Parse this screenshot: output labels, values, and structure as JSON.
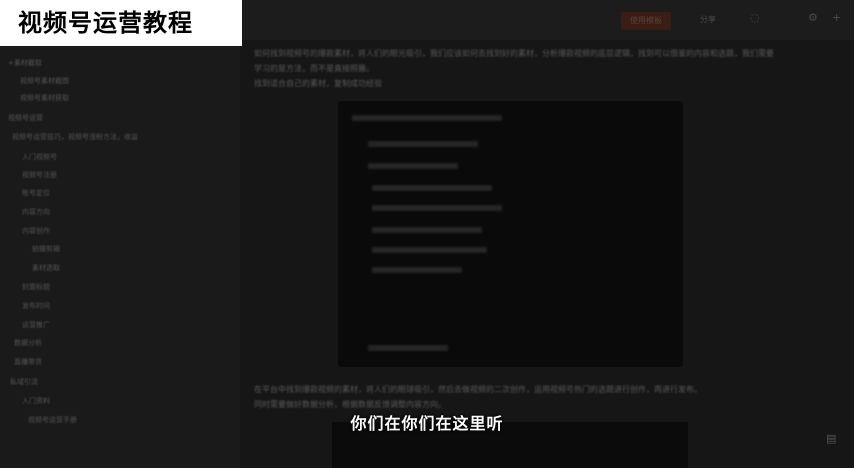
{
  "banner": {
    "title": "视频号运营教程"
  },
  "subtitle": "你们在你们在这里听",
  "topbar": {
    "primary_button": "使用模板",
    "link": "分享",
    "icons": [
      "bell-icon",
      "gear-icon",
      "plus-icon"
    ]
  },
  "sidebar": {
    "items": [
      "+素材截取",
      "视频号素材截图",
      "视频号素材获取",
      "视频号运营",
      "视频号运营技巧，视频号涨粉方法，收益",
      "入门视频号",
      "视频号注册",
      "账号定位",
      "内容方向",
      "内容创作",
      "拍摄剪辑",
      "素材选取",
      "封面标题",
      "发布时间",
      "运营推广",
      "数据分析",
      "直播带货",
      "私域引流",
      "入门资料",
      "视频号运营手册"
    ]
  },
  "content": {
    "paragraph1": "如何找到视频号的爆款素材，将人们的眼光吸引，我们应该如何去找到好的素材，分析爆款视频的底层逻辑，找到可以借鉴的内容和选题，我们需要学习的是方法，而不是直接照搬。",
    "paragraph1_line3": "找到适合自己的素材，复制成功经验",
    "paragraph2": "在平台中找到爆款视频的素材，将人们的眼球吸引，然后去做视频的二次创作，运用视频号热门的选题进行创作，再进行发布。",
    "paragraph2_line2": "同时需要做好数据分析，根据数据反馈调整内容方向。"
  }
}
